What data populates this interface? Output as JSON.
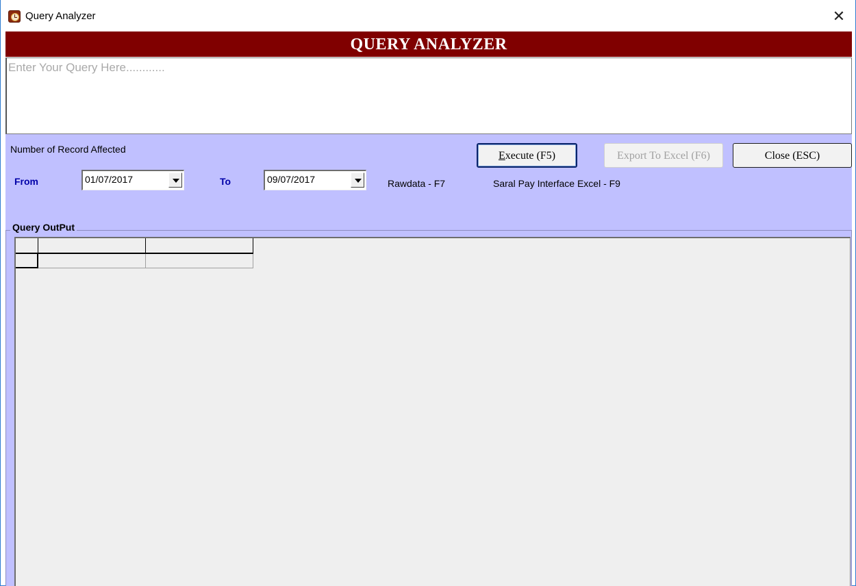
{
  "window": {
    "title": "Query Analyzer",
    "close_glyph": "✕",
    "app_icon": "clock-app-icon"
  },
  "banner": {
    "title": "QUERY ANALYZER",
    "bg_color": "#800000"
  },
  "query": {
    "placeholder": "Enter Your Query Here............",
    "value": ""
  },
  "controls": {
    "records_label": "Number of Record Affected",
    "from_label": "From",
    "from_date": "01/07/2017",
    "to_label": "To",
    "to_date": "09/07/2017",
    "rawdata_hint": "Rawdata  - F7",
    "saral_hint": "Saral Pay Interface Excel  - F9",
    "panel_color": "#c0c0ff"
  },
  "buttons": {
    "execute_prefix": "E",
    "execute_rest": "xecute (F5)",
    "export": "Export To Excel (F6)",
    "export_enabled": false,
    "close": "Close (ESC)"
  },
  "output": {
    "legend": "Query OutPut",
    "columns": [
      "",
      ""
    ],
    "rows": [
      [
        "",
        ""
      ]
    ]
  }
}
